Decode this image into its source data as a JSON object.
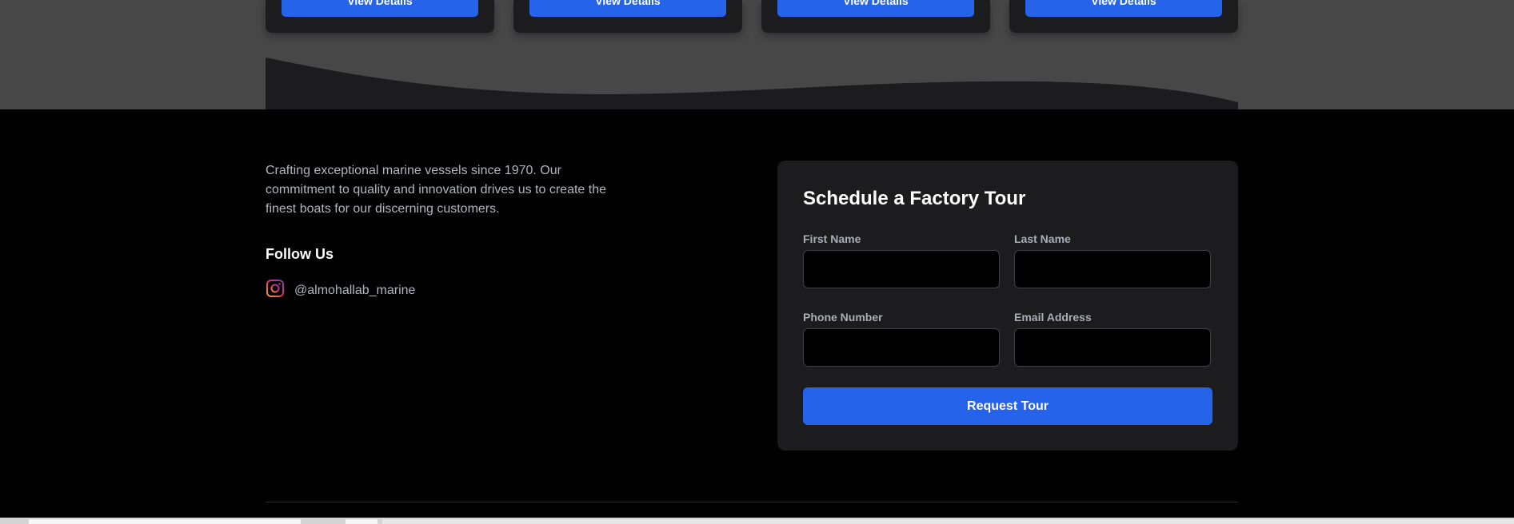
{
  "cards": [
    {
      "button_label": "View Details"
    },
    {
      "button_label": "View Details"
    },
    {
      "button_label": "View Details"
    },
    {
      "button_label": "View Details"
    }
  ],
  "footer": {
    "description": "Crafting exceptional marine vessels since 1970. Our commitment to quality and innovation drives us to create the finest boats for our discerning customers.",
    "follow_title": "Follow Us",
    "instagram_icon": "instagram-icon",
    "instagram_handle": "@almohallab_marine"
  },
  "tour_form": {
    "title": "Schedule a Factory Tour",
    "first_name_label": "First Name",
    "first_name_value": "",
    "last_name_label": "Last Name",
    "last_name_value": "",
    "phone_label": "Phone Number",
    "phone_value": "",
    "email_label": "Email Address",
    "email_value": "",
    "submit_label": "Request Tour"
  },
  "colors": {
    "accent": "#2563eb",
    "background": "#000000",
    "card": "#1c1c1e",
    "band": "#474747"
  }
}
